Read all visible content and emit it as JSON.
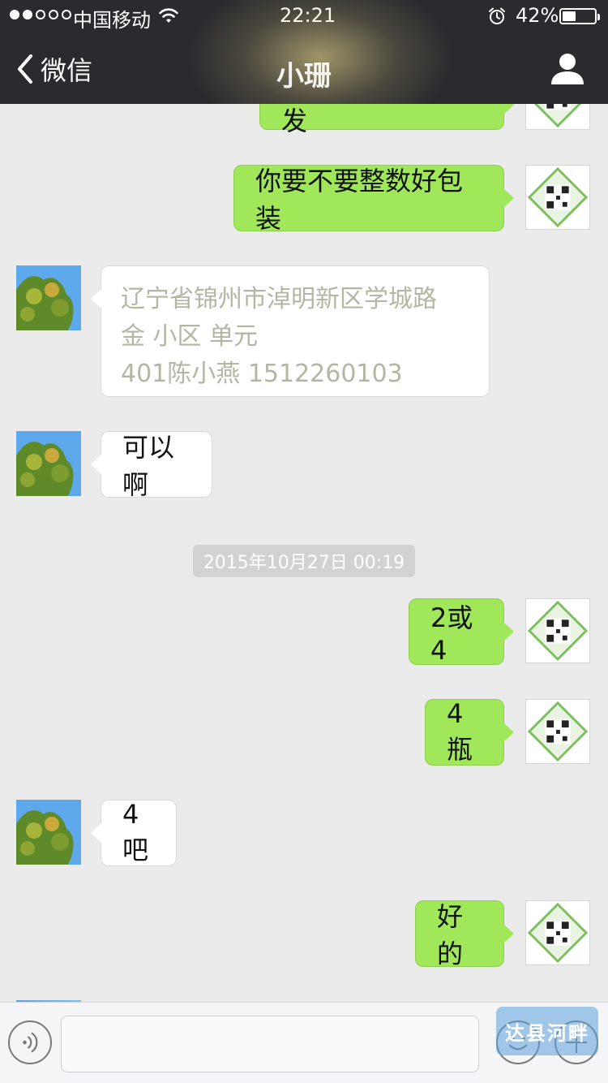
{
  "status_bar": {
    "carrier": "中国移动",
    "time": "22:21",
    "battery_percent_text": "42%",
    "battery_level": 0.42,
    "signal_dots_filled": 2,
    "signal_dots_total": 5,
    "icons": [
      "wifi-icon",
      "alarm-icon",
      "battery-icon"
    ]
  },
  "nav": {
    "back_label": "微信",
    "title": "小珊",
    "back_icon": "chevron-left-icon",
    "profile_icon": "person-icon"
  },
  "messages": [
    {
      "id": "m0",
      "direction": "out",
      "text": "明天发快递一起发"
    },
    {
      "id": "m1",
      "direction": "out",
      "text": "你要不要整数好包装"
    },
    {
      "id": "m2",
      "direction": "in",
      "lines": [
        "辽宁省锦州市淖明新区学城路",
        "金      小区          单元",
        "401陈小燕"
      ],
      "phone": "1512260103"
    },
    {
      "id": "m3",
      "direction": "in",
      "text": "可以啊"
    },
    {
      "id": "m4",
      "direction": "out",
      "text": "2或4"
    },
    {
      "id": "m5",
      "direction": "out",
      "text": "4瓶"
    },
    {
      "id": "m6",
      "direction": "in",
      "text": "4吧"
    },
    {
      "id": "m7",
      "direction": "out",
      "text": "好的"
    }
  ],
  "timestamp": "2015年10月27日 00:19",
  "input_bar": {
    "placeholder": "",
    "value": "",
    "voice_icon": "voice-icon",
    "emoji_icon": "emoji-icon",
    "plus_icon": "plus-icon"
  },
  "watermark": "达县河畔",
  "colors": {
    "topbar": "#2b2b2f",
    "chat_background": "#ebebeb",
    "outgoing_bubble": "#a0e75a",
    "incoming_bubble": "#ffffff",
    "timestamp_background": "#d2d2d2",
    "phone_link": "#3a86c8"
  },
  "avatars": {
    "self": "qr-code-avatar",
    "contact": "tree-photo-avatar"
  }
}
